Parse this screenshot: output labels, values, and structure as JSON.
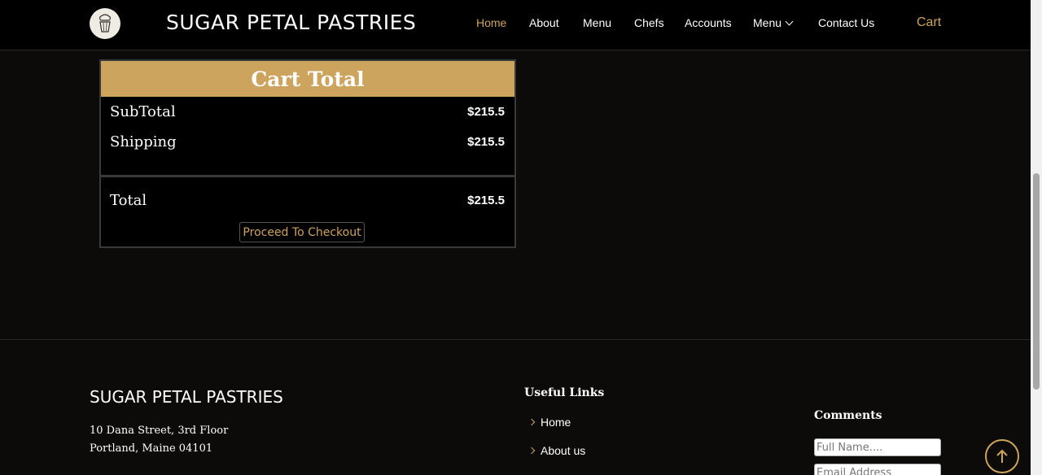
{
  "header": {
    "brand": "SUGAR PETAL PASTRIES",
    "nav": [
      {
        "label": "Home",
        "active": true
      },
      {
        "label": "About"
      },
      {
        "label": "Menu"
      },
      {
        "label": "Chefs"
      },
      {
        "label": "Accounts"
      },
      {
        "label": "Menu",
        "dropdown": true
      },
      {
        "label": "Contact Us"
      }
    ],
    "cart": "Cart"
  },
  "cart_total": {
    "title": "Cart Total",
    "subtotal_label": "SubTotal",
    "subtotal_value": "$215.5",
    "shipping_label": "Shipping",
    "shipping_value": "$215.5",
    "total_label": "Total",
    "total_value": "$215.5",
    "checkout_button": "Proceed To Checkout"
  },
  "footer": {
    "brand": "SUGAR PETAL PASTRIES",
    "address_line1": "10 Dana Street, 3rd Floor",
    "address_line2": "Portland, Maine 04101",
    "useful_links_title": "Useful Links",
    "links": [
      "Home",
      "About us"
    ],
    "comments_title": "Comments",
    "name_placeholder": "Full Name....",
    "email_placeholder": "Email Address"
  },
  "colors": {
    "accent": "#cda45e",
    "background": "#0c0b09"
  },
  "icons": [
    "cupcake-logo-icon",
    "chevron-down-icon",
    "chevron-right-icon",
    "arrow-up-icon"
  ]
}
